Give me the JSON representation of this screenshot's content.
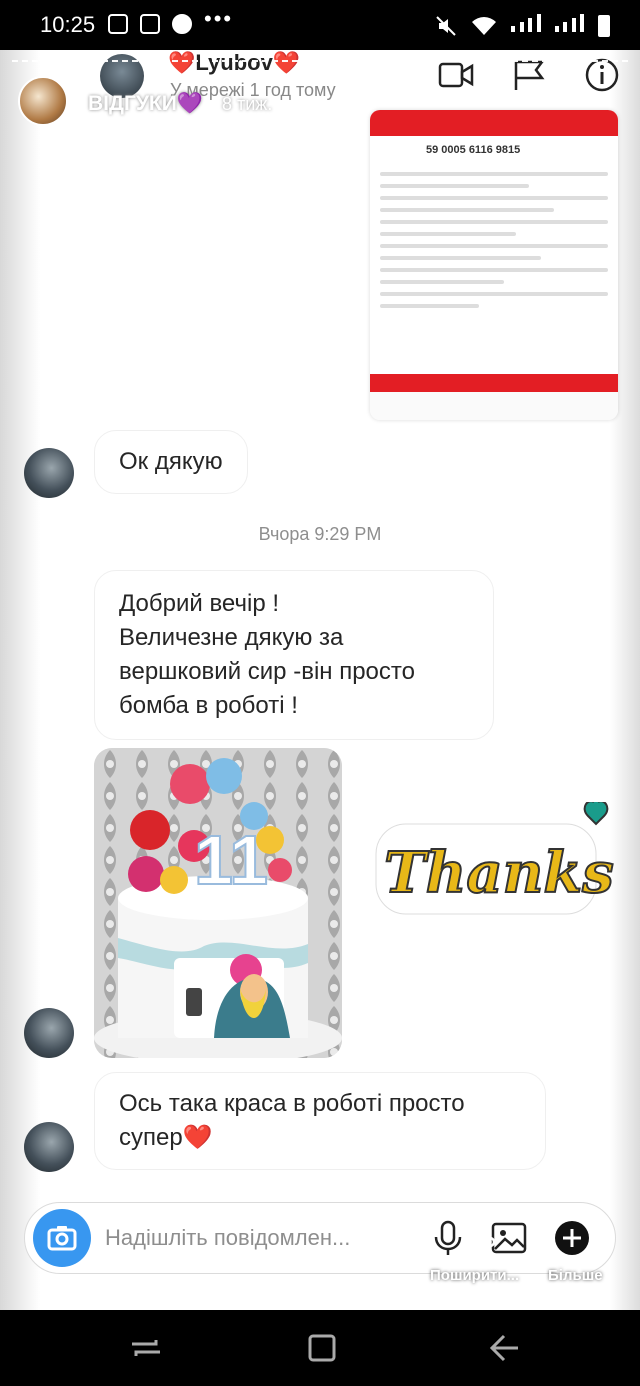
{
  "status_bar": {
    "time": "10:25",
    "dots": "•••"
  },
  "story": {
    "name": "ВІДГУКИ💜",
    "time": "8 тиж."
  },
  "header": {
    "name": "❤️Lyubov❤️",
    "status": "У мережі 1 год тому"
  },
  "screenshot_attachment": {
    "number": "59 0005 6116 9815",
    "accent": "#e31e24"
  },
  "messages": [
    {
      "text": "Ок дякую"
    },
    {
      "text": "Добрий вечір !\nВеличезне дякую за\nвершковий сир -він просто\nбомба в роботі !"
    },
    {
      "text": "Ось така краса в роботі просто\nсупер❤️"
    }
  ],
  "date_separator": "Вчора 9:29 PM",
  "cake_photo": {
    "topper_number": "11",
    "icon": "cake-photo"
  },
  "sticker": {
    "text": "Thanks"
  },
  "composer": {
    "placeholder": "Надішліть повідомлен...",
    "accent": "#3897f0"
  },
  "story_actions": {
    "share_label": "Поширити...",
    "more_label": "Більше"
  }
}
